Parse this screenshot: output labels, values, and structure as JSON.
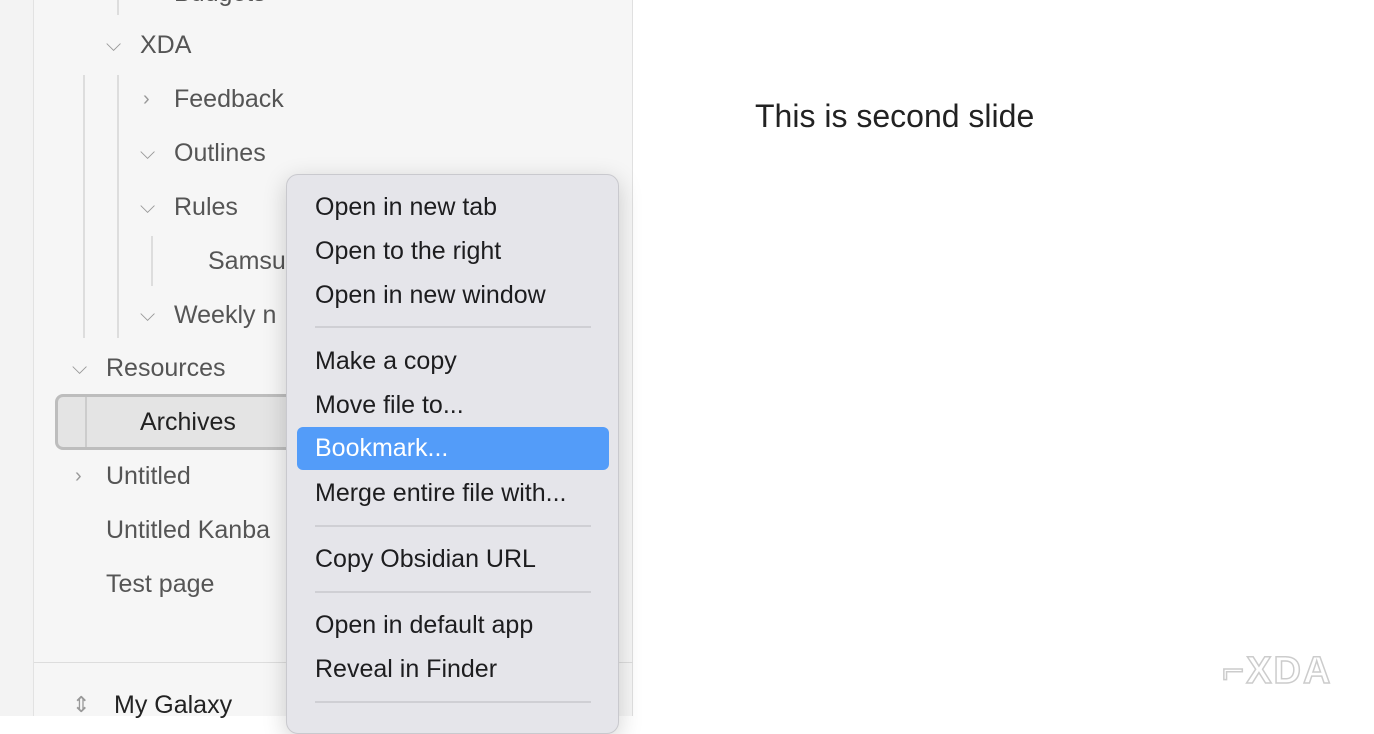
{
  "sidebar": {
    "items": [
      {
        "label": "Budgets",
        "chevron": "none"
      },
      {
        "label": "XDA",
        "chevron": "chevron-down"
      },
      {
        "label": "Feedback",
        "chevron": "chevron-right"
      },
      {
        "label": "Outlines",
        "chevron": "chevron-down"
      },
      {
        "label": "Rules",
        "chevron": "chevron-down"
      },
      {
        "label": "Samsu",
        "chevron": "none"
      },
      {
        "label": "Weekly n",
        "chevron": "chevron-down"
      },
      {
        "label": "Resources",
        "chevron": "chevron-down"
      },
      {
        "label": "Archives",
        "chevron": "none",
        "selected": true
      },
      {
        "label": "Untitled",
        "chevron": "chevron-right"
      },
      {
        "label": "Untitled Kanba",
        "chevron": "none"
      },
      {
        "label": "Test page",
        "chevron": "none"
      }
    ],
    "vault": "My Galaxy"
  },
  "context_menu": {
    "items": [
      "Open in new tab",
      "Open to the right",
      "Open in new window",
      "Make a copy",
      "Move file to...",
      "Bookmark...",
      "Merge entire file with...",
      "Copy Obsidian URL",
      "Open in default app",
      "Reveal in Finder"
    ],
    "highlighted": "Bookmark...",
    "highlight_color": "#539cf9"
  },
  "editor": {
    "content": "This is second slide"
  },
  "watermark": "XDA"
}
